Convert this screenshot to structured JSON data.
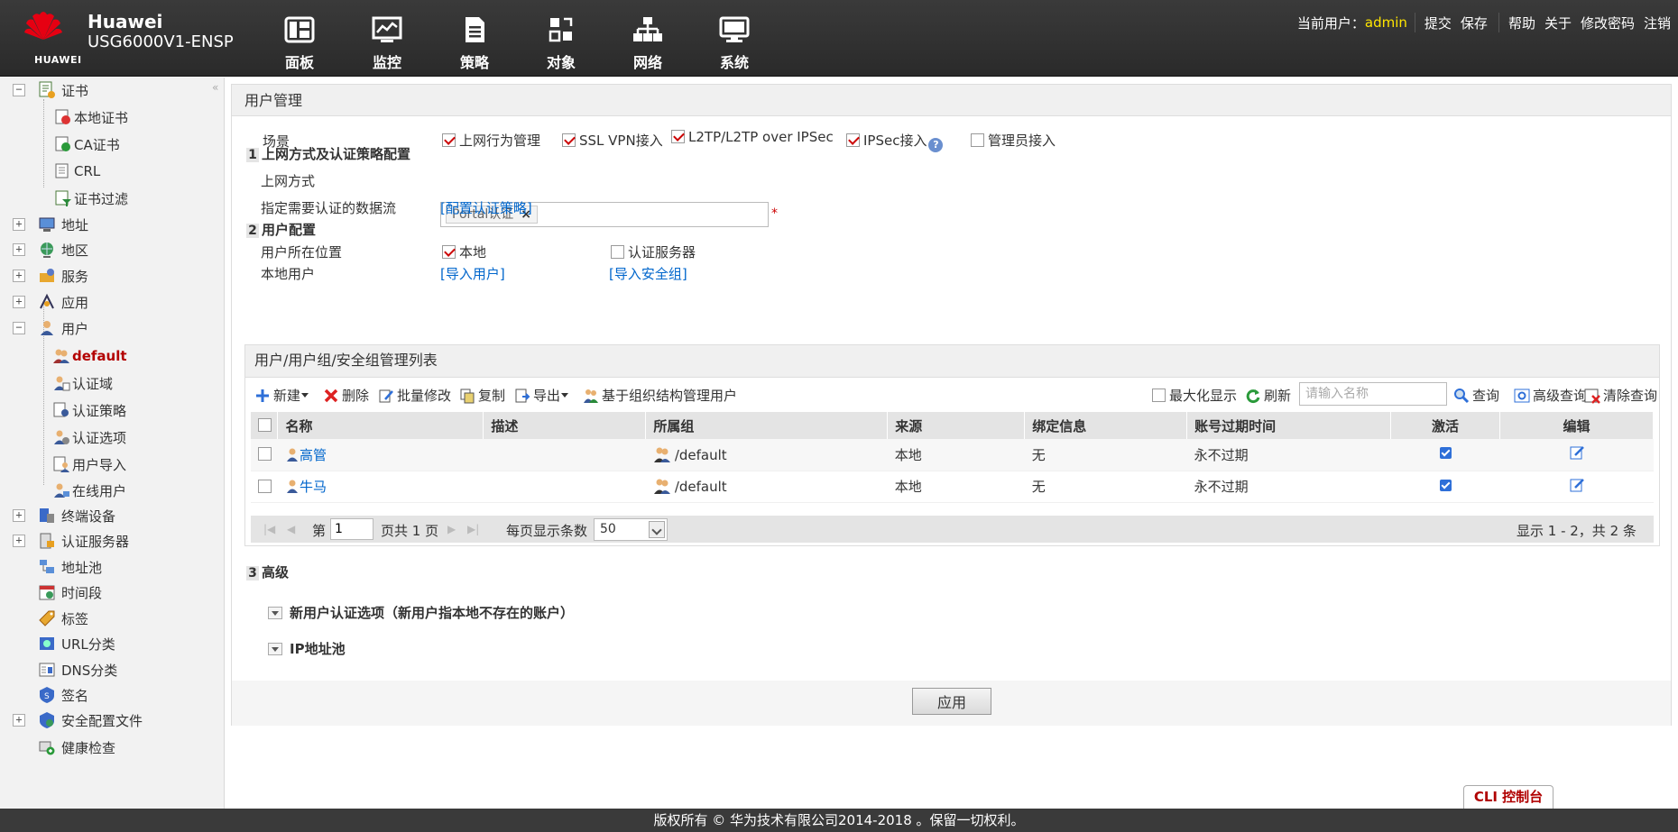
{
  "header": {
    "logo_text": "HUAWEI",
    "brand_line1": "Huawei",
    "brand_line2": "USG6000V1-ENSP",
    "nav": [
      {
        "label": "面板",
        "icon": "dashboard-icon"
      },
      {
        "label": "监控",
        "icon": "monitor-icon"
      },
      {
        "label": "策略",
        "icon": "policy-icon"
      },
      {
        "label": "对象",
        "icon": "object-icon"
      },
      {
        "label": "网络",
        "icon": "network-icon"
      },
      {
        "label": "系统",
        "icon": "system-icon"
      }
    ],
    "current_user_label": "当前用户：",
    "current_user": "admin",
    "links": {
      "submit": "提交",
      "save": "保存",
      "help": "帮助",
      "about": "关于",
      "change_password": "修改密码",
      "logout": "注销"
    }
  },
  "sidebar": {
    "collapse_glyph": "«",
    "items": [
      {
        "label": "证书",
        "expand": "−"
      },
      {
        "label": "本地证书"
      },
      {
        "label": "CA证书"
      },
      {
        "label": "CRL"
      },
      {
        "label": "证书过滤"
      },
      {
        "label": "地址",
        "expand": "+"
      },
      {
        "label": "地区",
        "expand": "+"
      },
      {
        "label": "服务",
        "expand": "+"
      },
      {
        "label": "应用",
        "expand": "+"
      },
      {
        "label": "用户",
        "expand": "−"
      },
      {
        "label": "default"
      },
      {
        "label": "认证域"
      },
      {
        "label": "认证策略"
      },
      {
        "label": "认证选项"
      },
      {
        "label": "用户导入"
      },
      {
        "label": "在线用户"
      },
      {
        "label": "终端设备",
        "expand": "+"
      },
      {
        "label": "认证服务器",
        "expand": "+"
      },
      {
        "label": "地址池"
      },
      {
        "label": "时间段"
      },
      {
        "label": "标签"
      },
      {
        "label": "URL分类"
      },
      {
        "label": "DNS分类"
      },
      {
        "label": "签名"
      },
      {
        "label": "安全配置文件",
        "expand": "+"
      },
      {
        "label": "健康检查"
      }
    ]
  },
  "main": {
    "title": "用户管理",
    "scene": {
      "label": "场景",
      "options": [
        {
          "label": "上网行为管理",
          "checked": true
        },
        {
          "label": "SSL VPN接入",
          "checked": true
        },
        {
          "label": "L2TP/L2TP over IPSec",
          "checked": true
        },
        {
          "label": "IPSec接入",
          "checked": true
        },
        {
          "label": "管理员接入",
          "checked": false
        }
      ],
      "help_glyph": "?"
    },
    "step1": {
      "num": "1",
      "title": "上网方式及认证策略配置",
      "access_label": "上网方式",
      "access_tag": "Portal认证",
      "tag_remove": "×",
      "required_mark": "*",
      "flow_label": "指定需要认证的数据流",
      "flow_link": "[配置认证策略]"
    },
    "step2": {
      "num": "2",
      "title": "用户配置",
      "location_label": "用户所在位置",
      "loc_local": "本地",
      "loc_server": "认证服务器",
      "local_user_label": "本地用户",
      "import_user": "[导入用户]",
      "import_group": "[导入安全组]"
    },
    "list": {
      "title": "用户/用户组/安全组管理列表",
      "toolbar": {
        "new": "新建",
        "delete": "删除",
        "batch_edit": "批量修改",
        "copy": "复制",
        "export": "导出",
        "org_manage": "基于组织结构管理用户",
        "maximize": "最大化显示",
        "refresh": "刷新",
        "search_placeholder": "请输入名称",
        "query": "查询",
        "advanced_query": "高级查询",
        "clear_query": "清除查询"
      },
      "columns": [
        "名称",
        "描述",
        "所属组",
        "来源",
        "绑定信息",
        "账号过期时间",
        "激活",
        "编辑"
      ],
      "rows": [
        {
          "name": "高管",
          "desc": "",
          "group": "/default",
          "source": "本地",
          "binding": "无",
          "expire": "永不过期",
          "active": true
        },
        {
          "name": "牛马",
          "desc": "",
          "group": "/default",
          "source": "本地",
          "binding": "无",
          "expire": "永不过期",
          "active": true
        }
      ],
      "pager": {
        "first": "|◀",
        "prev": "◀",
        "next": "▶",
        "last": "▶|",
        "page_prefix": "第",
        "page_value": "1",
        "page_suffix": "页共 1 页",
        "per_page_label": "每页显示条数",
        "per_page": "50",
        "summary": "显示 1 - 2，共 2 条"
      }
    },
    "step3": {
      "num": "3",
      "title": "高级",
      "sections": [
        "新用户认证选项（新用户指本地不存在的账户）",
        "IP地址池"
      ]
    },
    "apply_button": "应用"
  },
  "cli_button": "CLI 控制台",
  "copyright": "版权所有 © 华为技术有限公司2014-2018 。保留一切权利。",
  "colors": {
    "header_bg": "#333333",
    "current_user": "#ffe500",
    "link": "#0066cc",
    "active_item": "#b30000"
  }
}
